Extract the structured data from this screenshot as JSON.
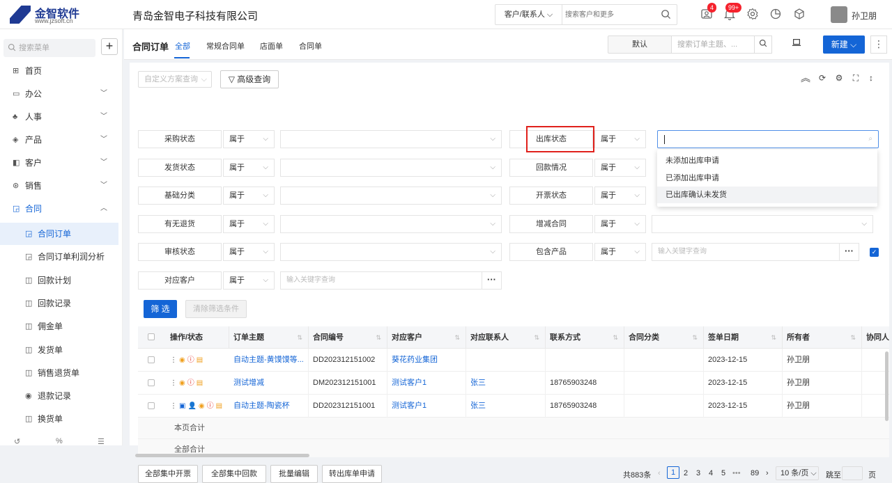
{
  "header": {
    "logo_name": "金智软件",
    "logo_url": "www.jzsoft.cn",
    "company": "青岛金智电子科技有限公司",
    "search_type": "客户/联系人",
    "search_placeholder": "搜索客户和更多",
    "badge_user": "4",
    "badge_msg": "99+",
    "username": "孙卫朋"
  },
  "sidebar": {
    "search_placeholder": "搜索菜单",
    "items": [
      {
        "label": "首页",
        "icon": "home-icon",
        "glyph": "⊞"
      },
      {
        "label": "办公",
        "icon": "office-icon",
        "glyph": "▭"
      },
      {
        "label": "人事",
        "icon": "people-icon",
        "glyph": "♣"
      },
      {
        "label": "产品",
        "icon": "product-icon",
        "glyph": "◈"
      },
      {
        "label": "客户",
        "icon": "customer-icon",
        "glyph": "◧"
      },
      {
        "label": "销售",
        "icon": "sales-icon",
        "glyph": "⊛"
      },
      {
        "label": "合同",
        "icon": "contract-icon",
        "glyph": "◲"
      }
    ],
    "sub_items": [
      {
        "label": "合同订单"
      },
      {
        "label": "合同订单利润分析"
      },
      {
        "label": "回款计划"
      },
      {
        "label": "回款记录"
      },
      {
        "label": "佣金单"
      },
      {
        "label": "发货单"
      },
      {
        "label": "销售退货单"
      },
      {
        "label": "退款记录"
      },
      {
        "label": "换货单"
      }
    ]
  },
  "toolbar": {
    "title": "合同订单",
    "tabs": [
      "全部",
      "常规合同单",
      "店面单",
      "合同单"
    ],
    "view_select": "默认",
    "search_placeholder": "搜索订单主题、...",
    "new_label": "新建"
  },
  "filters": {
    "scheme_placeholder": "自定义方案查询",
    "advanced_label": "高级查询",
    "op_label": "属于",
    "keyword_placeholder": "输入关键字查询",
    "left": [
      "采购状态",
      "发货状态",
      "基础分类",
      "有无退货",
      "审核状态",
      "对应客户"
    ],
    "right": [
      "出库状态",
      "回款情况",
      "开票状态",
      "增减合同",
      "包含产品"
    ],
    "dropdown_options": [
      "未添加出库申请",
      "已添加出库申请",
      "已出库确认未发货"
    ],
    "filter_label": "筛 选",
    "clear_label": "清除筛选条件"
  },
  "table": {
    "columns": [
      "操作/状态",
      "订单主题",
      "合同编号",
      "对应客户",
      "对应联系人",
      "联系方式",
      "合同分类",
      "签单日期",
      "所有者",
      "协同人"
    ],
    "rows": [
      {
        "subject": "自动主题-黄馍馍等...",
        "code": "DD202312151002",
        "customer": "葵花药业集团",
        "contact": "",
        "phone": "",
        "category": "",
        "date": "2023-12-15",
        "owner": "孙卫朋"
      },
      {
        "subject": "测试增减",
        "code": "DM202312151001",
        "customer": "测试客户1",
        "contact": "张三",
        "phone": "18765903248",
        "category": "",
        "date": "2023-12-15",
        "owner": "孙卫朋"
      },
      {
        "subject": "自动主题-陶瓷杯",
        "code": "DD202312151001",
        "customer": "测试客户1",
        "contact": "张三",
        "phone": "18765903248",
        "category": "",
        "date": "2023-12-15",
        "owner": "孙卫朋"
      }
    ],
    "page_total": "本页合计",
    "all_total": "全部合计"
  },
  "footer": {
    "buttons": [
      "全部集中开票",
      "全部集中回款",
      "批量编辑",
      "转出库单申请"
    ],
    "total": "共883条",
    "pages": [
      "1",
      "2",
      "3",
      "4",
      "5",
      "•••",
      "89"
    ],
    "page_size": "10 条/页",
    "jump_label": "跳至",
    "page_unit": "页"
  },
  "colors": {
    "accent": "#1465d6",
    "highlight_border": "#e0201b",
    "badge": "#f5222d"
  }
}
